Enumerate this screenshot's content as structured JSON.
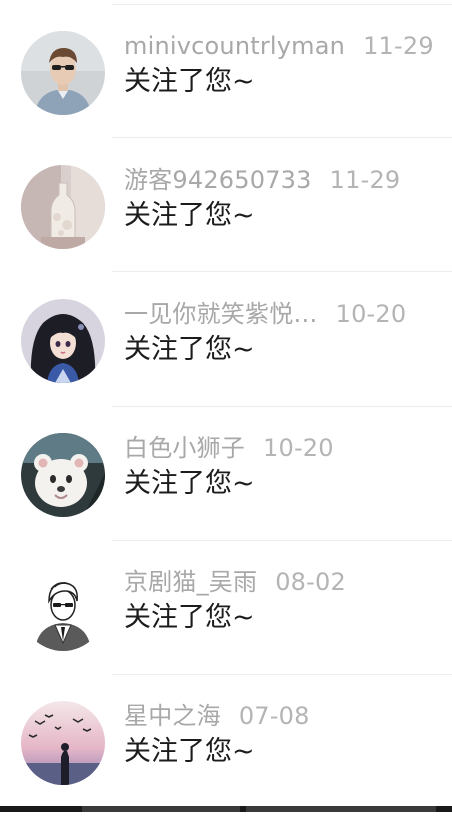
{
  "notifications": [
    {
      "username": "minivcountrlyman",
      "date": "11-29",
      "message": "关注了您~",
      "avatar": "avatar-man-sunglasses"
    },
    {
      "username": "游客942650733",
      "date": "11-29",
      "message": "关注了您~",
      "avatar": "avatar-candle-bottle"
    },
    {
      "username": "一见你就笑紫悦…",
      "date": "10-20",
      "message": "关注了您~",
      "avatar": "avatar-anime-girl"
    },
    {
      "username": "白色小狮子",
      "date": "10-20",
      "message": "关注了您~",
      "avatar": "avatar-white-lion"
    },
    {
      "username": "京剧猫_吴雨",
      "date": "08-02",
      "message": "关注了您~",
      "avatar": "avatar-sketch-man"
    },
    {
      "username": "星中之海",
      "date": "07-08",
      "message": "关注了您~",
      "avatar": "avatar-sunset-birds"
    }
  ]
}
